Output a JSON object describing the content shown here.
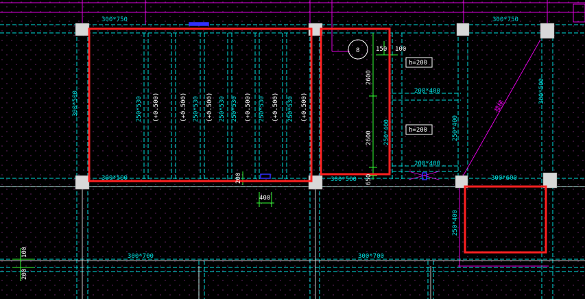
{
  "colors": {
    "background": "#000000",
    "cyan": "#00e0e0",
    "magenta": "#e000e0",
    "red": "#ff2020",
    "green": "#33ff33",
    "white": "#ffffff",
    "grid_dot": "#5a1a5a",
    "column": "#d0d0d0",
    "blue": "#3030ff"
  },
  "labels": {
    "beam_top_left": "300*750",
    "beam_top_right": "300*750",
    "beam_left_vertical": "300*500",
    "beam_bottom_left": "300*500",
    "beam_bottom_mid": "300*500",
    "beam_right_vertical": "300*500",
    "joist_1": "250*530",
    "joist_2": "(+0.500)",
    "joist_3": "(+0.500)",
    "joist_4": "250*530",
    "joist_5": "(+0.500)",
    "joist_6": "250*530",
    "joist_7": "250*530",
    "joist_8": "(+0.500)",
    "joist_9": "250*530",
    "joist_10": "(+0.500)",
    "joist_11": "250*530",
    "joist_12": "(+0.500)",
    "beam_edge_right": "300*500",
    "dim_150": "150",
    "dim_100": "100",
    "dim_2600_top": "2600",
    "dim_2600_bottom": "2600",
    "dim_650": "650",
    "dim_200_small": "200",
    "dim_400": "400",
    "vertical_beam_mid": "250*400",
    "h_label_1": "h=200",
    "h_label_2": "h=200",
    "beam_200_400_top": "200*400",
    "beam_200_400_bottom": "200*400",
    "beam_250_400_right": "250*400",
    "beam_300_600": "300*600",
    "beam_250_400_lower": "250*400",
    "beam_300_700_left": "300*700",
    "beam_300_700_mid": "300*700",
    "diag_label": "楼梯",
    "axis_bubble": "8",
    "dim_left_100": "100",
    "dim_left_200": "200"
  }
}
